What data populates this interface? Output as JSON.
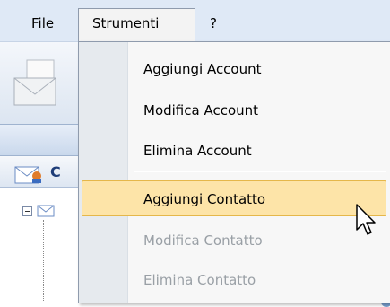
{
  "menubar": {
    "file_label": "File",
    "strumenti_label": "Strumenti",
    "help_label": "?"
  },
  "app": {
    "header_text": "C"
  },
  "dropdown": {
    "items": [
      {
        "label": "Aggiungi Account",
        "enabled": true
      },
      {
        "label": "Modifica Account",
        "enabled": true
      },
      {
        "label": "Elimina Account",
        "enabled": true
      },
      {
        "label": "Aggiungi Contatto",
        "enabled": true,
        "highlighted": true
      },
      {
        "label": "Modifica Contatto",
        "enabled": false
      },
      {
        "label": "Elimina Contatto",
        "enabled": false
      }
    ]
  },
  "colors": {
    "highlight": "#fde4a8",
    "disabled_text": "#9aa0a6",
    "menubar": "#dfe9f6"
  }
}
